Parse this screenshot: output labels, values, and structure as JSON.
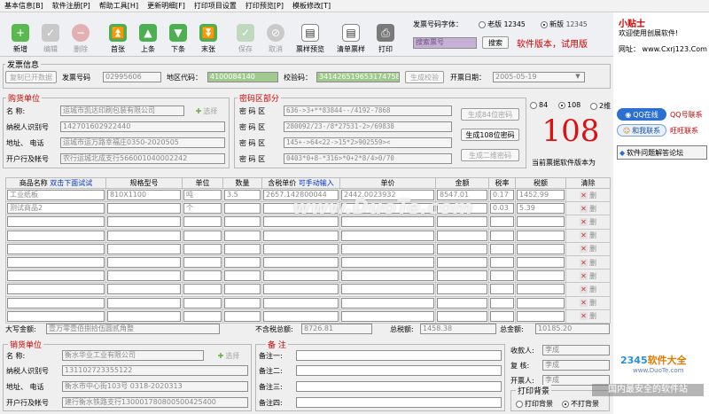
{
  "menu": [
    "基本信息[B]",
    "软件注册[P]",
    "帮助工具[H]",
    "更新明细[F]",
    "打印项目设置",
    "打印预览[P]",
    "模板修改[T]"
  ],
  "toolbar": {
    "new": "新增",
    "edit": "编辑",
    "del": "删除",
    "first": "首张",
    "prev": "上条",
    "next": "下条",
    "last": "末张",
    "save": "保存",
    "cancel": "取消",
    "preview": "票样预览",
    "list": "清单票样",
    "print": "打印"
  },
  "font_selector": {
    "label": "发票号码字体：",
    "old": "老版",
    "old_sample": "12345",
    "new": "新版",
    "new_sample": "12345",
    "search_placeholder": "搜索票号",
    "search_btn": "搜索",
    "version": "软件版本，试用版"
  },
  "invoice": {
    "legend": "发票信息",
    "copy_btn": "复制已开数据",
    "no_label": "发票号码",
    "no": "02995606",
    "area_label": "地区代码：",
    "area": "4100084140",
    "check_label": "校验码：",
    "check": "34142651965317475802",
    "check_btn": "生成校验",
    "date_label": "开票日期：",
    "date": "2005-05-19"
  },
  "buyer": {
    "legend": "购货单位",
    "name_label": "名  称:",
    "name": "运城市凯达印刷包装有限公司",
    "select_btn": "选择",
    "tax_label": "纳税人识别号",
    "tax": "142701602922440",
    "addr_label": "地址、 电话",
    "addr": "运城市运万路幸福庄0350-2020505",
    "bank_label": "开户行及帐号",
    "bank": "农行运城北成支行566001040002242"
  },
  "password": {
    "legend": "密码区部分",
    "label": "密  码  区",
    "rows": [
      "636->3+**83844--/4192-7868",
      "280092/23-/8*27531-2>/69838",
      "145+->64<22->15*2>902559><",
      "0403*0+8-*316>*0+2*8/4>0/70"
    ],
    "btn84": "生成84位密码",
    "btn108": "生成108位密码",
    "btn2d": "生成二维密码"
  },
  "version_box": {
    "opt84": "84",
    "opt108": "108",
    "opt2d": "2维",
    "big": "108",
    "caption": "当前票据软件版本为"
  },
  "table": {
    "headers": [
      "商品名称",
      "双击下面试试",
      "规格型号",
      "单位",
      "数量",
      "含税单价",
      "可手动输入",
      "单价",
      "金额",
      "税率",
      "税额",
      "清除"
    ],
    "rows": [
      [
        "工业纸板",
        "810X1100",
        "吨",
        "3.5",
        "2657.142800044",
        "2442.0023932",
        "8547.01",
        "0.17",
        "1452.99",
        "删"
      ],
      [
        "测试商品2",
        "",
        "个",
        "",
        "",
        "",
        "",
        "0.03",
        "5.39",
        "删"
      ],
      [
        "",
        "",
        "",
        "",
        "",
        "",
        "",
        "",
        "",
        "删"
      ],
      [
        "",
        "",
        "",
        "",
        "",
        "",
        "",
        "",
        "",
        "删"
      ],
      [
        "",
        "",
        "",
        "",
        "",
        "",
        "",
        "",
        "",
        "删"
      ],
      [
        "",
        "",
        "",
        "",
        "",
        "",
        "",
        "",
        "",
        "删"
      ],
      [
        "",
        "",
        "",
        "",
        "",
        "",
        "",
        "",
        "",
        "删"
      ],
      [
        "",
        "",
        "",
        "",
        "",
        "",
        "",
        "",
        "",
        "删"
      ],
      [
        "",
        "",
        "",
        "",
        "",
        "",
        "",
        "",
        "",
        "删"
      ],
      [
        "",
        "",
        "",
        "",
        "",
        "",
        "",
        "",
        "",
        "删"
      ]
    ]
  },
  "totals": {
    "big_label": "大写金额:",
    "big": "壹万零壹佰捌拾伍圆贰角整",
    "notax_label": "不含税总额:",
    "notax": "8726.81",
    "tax_label": "总税额:",
    "tax": "1458.38",
    "total_label": "总金额:",
    "total": "10185.20"
  },
  "seller": {
    "legend": "销货单位",
    "name_label": "名  称:",
    "name": "衡水华业工业有限公司",
    "select_btn": "选择",
    "tax_label": "纳税人识别号",
    "tax": "131102723355122",
    "addr_label": "地址、 电话",
    "addr": "衡水市中心街103号 0318-2020313",
    "bank_label": "开户行及帐号",
    "bank": "建行衡水铁路支行130001780800500425400"
  },
  "notes": {
    "legend": "备  注",
    "labels": [
      "备注一:",
      "备注二:",
      "备注三:",
      "备注四:"
    ]
  },
  "staff": {
    "receiver_label": "收款人:",
    "receiver": "李成",
    "reviewer_label": "复  核:",
    "reviewer": "李成",
    "issuer_label": "开票人:",
    "issuer": "李成",
    "bg_label": "打印背景",
    "bg_on": "打印背景",
    "bg_off": "不打背景"
  },
  "sidebar": {
    "title": "小贴士",
    "welcome": "欢迎使用创展软件!",
    "site": "网址： www.Cxrj123.Com",
    "qq_btn": "QQ在线",
    "qq_label": "QQ号联系",
    "ww_btn": "和我联系",
    "ww_label": "旺旺联系",
    "faq": "软件问题解答论坛"
  },
  "watermark": {
    "site": "www.DuoTe.com",
    "brand_number": "2345",
    "brand": "软件大全",
    "brand_url": "www.DuoTe.com",
    "tagline": "国内最安全的软件站"
  }
}
